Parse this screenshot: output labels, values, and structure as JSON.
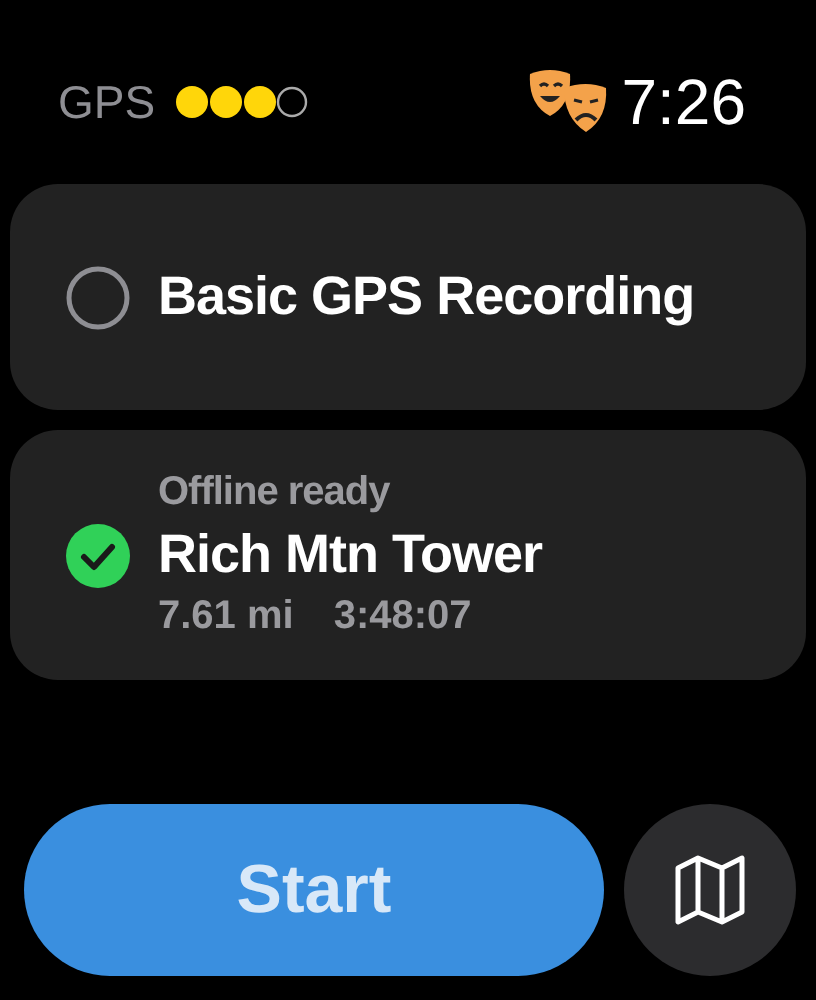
{
  "status_bar": {
    "label": "GPS",
    "time": "7:26"
  },
  "routes": [
    {
      "title": "Basic GPS Recording",
      "selected": false
    },
    {
      "subtitle": "Offline ready",
      "title": "Rich Mtn Tower",
      "distance": "7.61 mi",
      "duration": "3:48:07",
      "selected": true
    }
  ],
  "start_button": {
    "label": "Start"
  }
}
